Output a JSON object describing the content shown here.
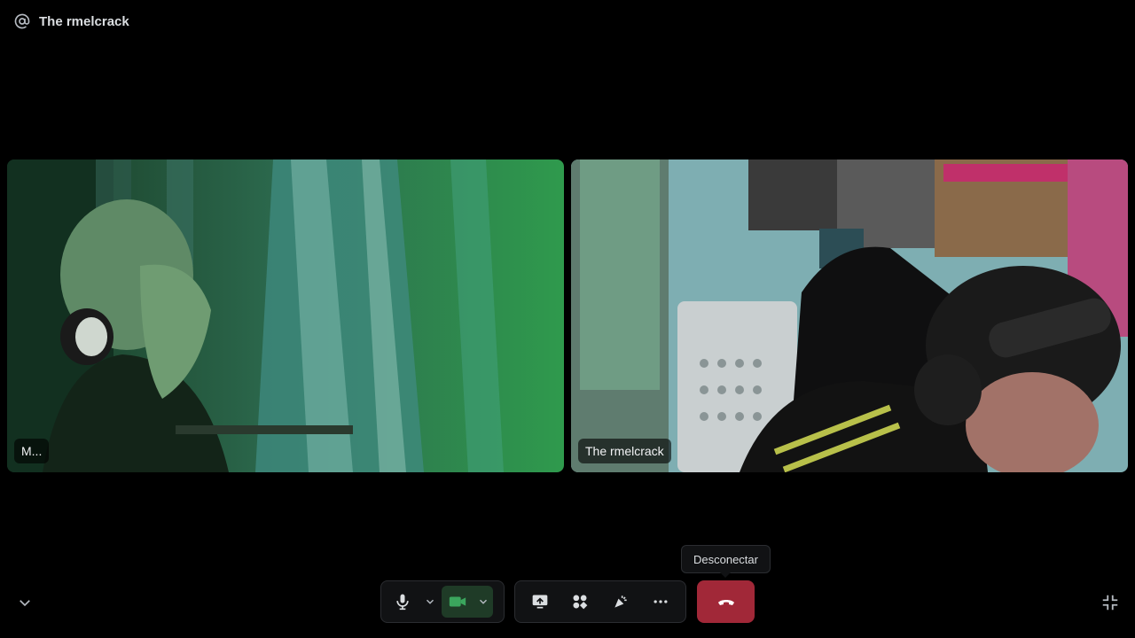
{
  "header": {
    "icon": "at-icon",
    "title": "The rmelcrack"
  },
  "participants": [
    {
      "name": "M..."
    },
    {
      "name": "The rmelcrack"
    }
  ],
  "controls": {
    "mic": "microphone-icon",
    "mic_options": "chevron-down-icon",
    "camera": "camera-icon",
    "camera_options": "chevron-down-icon",
    "screen_share": "screen-share-icon",
    "activities": "activities-icon",
    "soundboard": "soundboard-icon",
    "more": "more-icon",
    "disconnect": "hangup-icon"
  },
  "tooltip": {
    "text": "Desconectar"
  },
  "colors": {
    "background": "#000000",
    "disconnect": "#a12838",
    "camera_active": "#3ba55d",
    "control_bg": "#111214"
  }
}
